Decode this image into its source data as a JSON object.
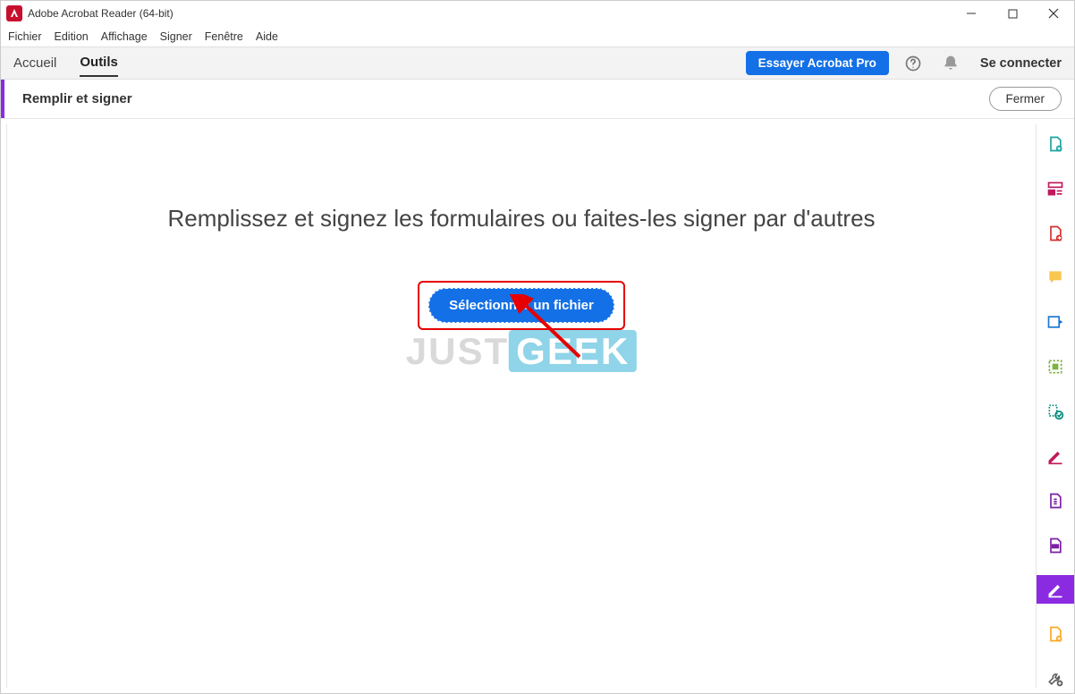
{
  "window": {
    "title": "Adobe Acrobat Reader (64-bit)"
  },
  "menubar": [
    "Fichier",
    "Edition",
    "Affichage",
    "Signer",
    "Fenêtre",
    "Aide"
  ],
  "topbar": {
    "tabs": {
      "home": "Accueil",
      "tools": "Outils"
    },
    "try_button": "Essayer Acrobat Pro",
    "signin": "Se connecter"
  },
  "contextbar": {
    "title": "Remplir et signer",
    "close": "Fermer"
  },
  "main": {
    "heading": "Remplissez et signez les formulaires ou faites-les signer par d'autres",
    "select_file": "Sélectionner un fichier",
    "help": "Aide"
  },
  "watermark": {
    "part1": "JUST",
    "part2": "GEEK"
  },
  "right_tools": [
    {
      "name": "create-pdf-icon",
      "color": "#1aa3a3"
    },
    {
      "name": "form-layout-icon",
      "color": "#c2185b"
    },
    {
      "name": "export-pdf-icon",
      "color": "#d32f2f"
    },
    {
      "name": "comment-icon",
      "color": "#f9a825"
    },
    {
      "name": "send-sign-icon",
      "color": "#1976d2"
    },
    {
      "name": "organize-icon",
      "color": "#7cb342"
    },
    {
      "name": "edit-icon",
      "color": "#00897b"
    },
    {
      "name": "sign-pen-icon",
      "color": "#c2185b"
    },
    {
      "name": "compress-icon",
      "color": "#7b1fa2"
    },
    {
      "name": "redact-icon",
      "color": "#7b1fa2"
    },
    {
      "name": "fill-sign-icon",
      "color": "#ffffff",
      "active": true
    },
    {
      "name": "add-page-icon",
      "color": "#f9a825"
    },
    {
      "name": "more-tools-icon",
      "color": "#616161"
    }
  ]
}
